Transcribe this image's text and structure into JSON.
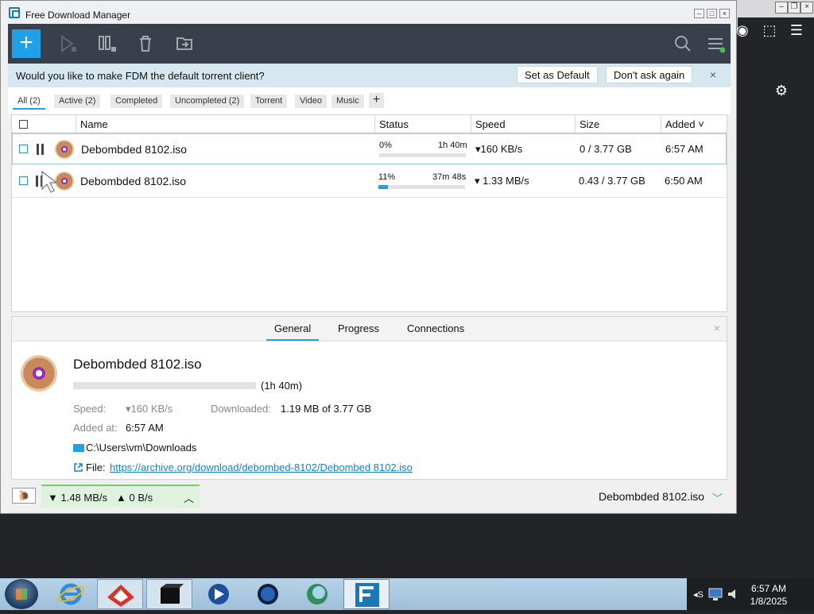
{
  "window": {
    "title": "Free Download Manager",
    "btn_min": "–",
    "btn_max": "□",
    "btn_close": "×"
  },
  "toolbar": {
    "add": "+",
    "icons": [
      "play-icon",
      "columns-icon",
      "trash-icon",
      "move-folder-icon",
      "search-icon",
      "menu-icon"
    ]
  },
  "banner": {
    "text": "Would you like to make FDM the default torrent client?",
    "set_default": "Set as Default",
    "dont_ask": "Don't ask again",
    "close": "×"
  },
  "filters": [
    "All (2)",
    "Active (2)",
    "Completed",
    "Uncompleted (2)",
    "Torrent",
    "Video",
    "Music"
  ],
  "filter_add": "+",
  "columns": {
    "name": "Name",
    "status": "Status",
    "speed": "Speed",
    "size": "Size",
    "added": "Added ˅"
  },
  "downloads": [
    {
      "name": "Debombded 8102.iso",
      "percent": "0%",
      "progress": 0,
      "eta": "1h 40m",
      "speed": "▾160 KB/s",
      "size": "0 / 3.77 GB",
      "added": "6:57 AM"
    },
    {
      "name": "Debombded 8102.iso",
      "percent": "11%",
      "progress": 0.11,
      "eta": "37m 48s",
      "speed": "▾ 1.33 MB/s",
      "size": "0.43 / 3.77 GB",
      "added": "6:50 AM"
    }
  ],
  "details": {
    "tabs": [
      "General",
      "Progress",
      "Connections"
    ],
    "close": "×",
    "name": "Debombded 8102.iso",
    "progress": 0,
    "eta": "(1h 40m)",
    "speed_label": "Speed:",
    "speed_value": "▾160 KB/s",
    "downloaded_label": "Downloaded:",
    "downloaded_value": "1.19 MB of 3.77 GB",
    "added_label": "Added at:",
    "added_value": "6:57 AM",
    "folder": "C:\\Users\\vm\\Downloads",
    "file_label": "File:",
    "file_url": "https://archive.org/download/debombed-8102/Debombed 8102.iso"
  },
  "statusbar": {
    "down": "▼ 1.48 MB/s",
    "up": "▲ 0 B/s",
    "current": "Debombded 8102.iso"
  },
  "taskbar": {
    "time": "6:57 AM",
    "date": "1/8/2025",
    "apps": [
      "internet-explorer",
      "app-red-diamond",
      "app-dark-box",
      "media-player",
      "app-globe",
      "app-globe-2",
      "free-download-manager"
    ]
  },
  "colors": {
    "accent": "#1ea1e6",
    "toolbar_bg": "#3a3f4c",
    "banner_bg": "#d6e7ef",
    "link": "#1b7fbd"
  }
}
